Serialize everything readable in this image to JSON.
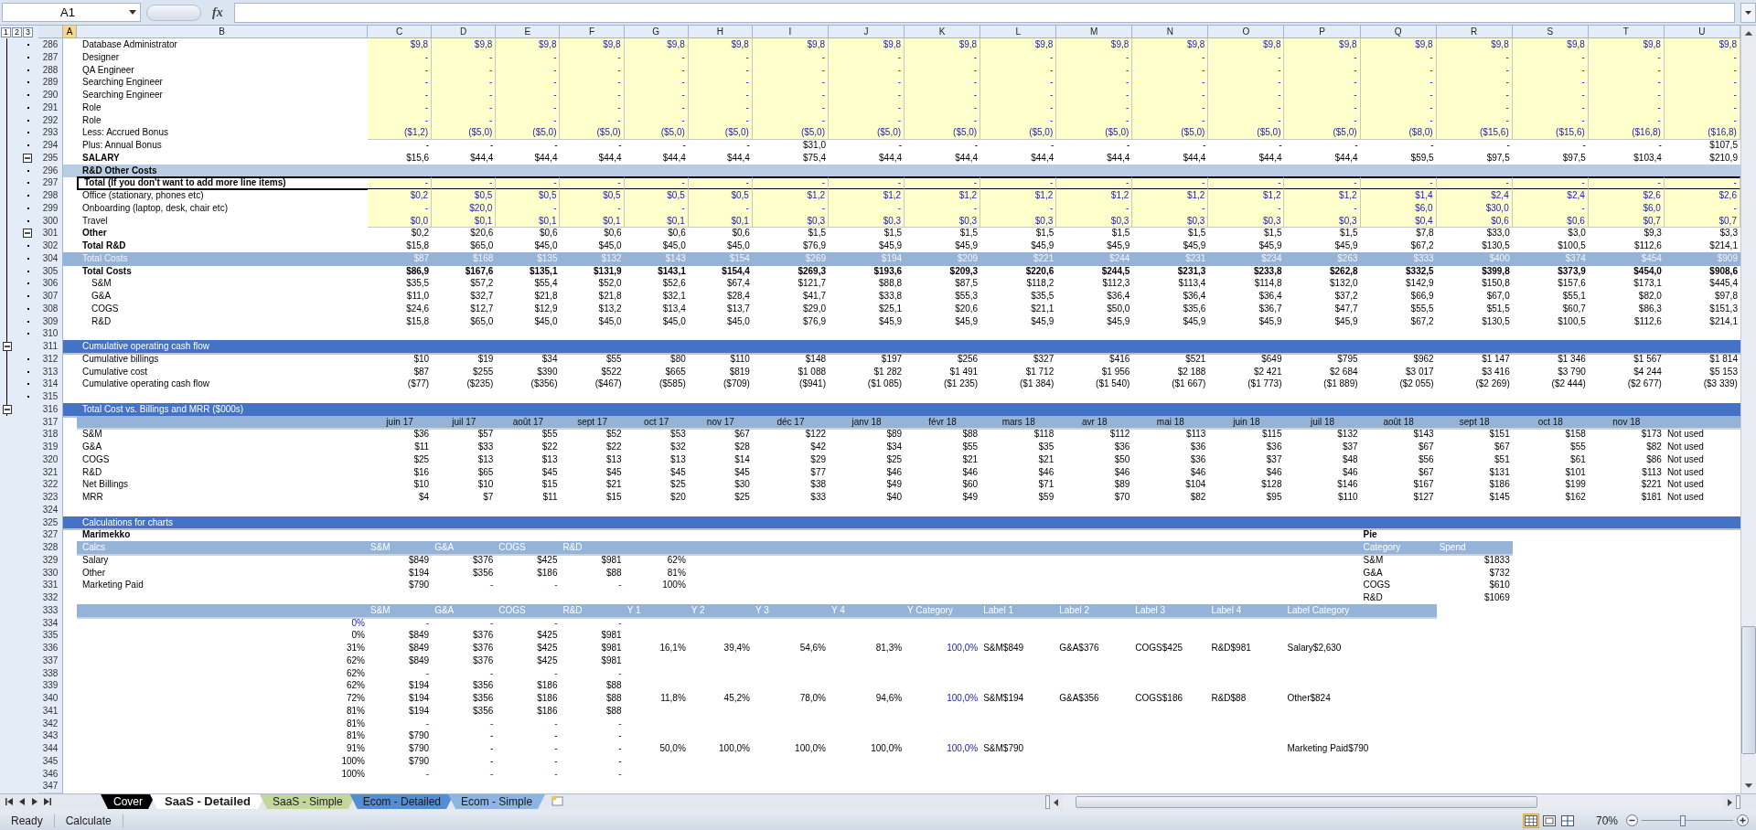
{
  "formula_bar": {
    "name_box": "A1",
    "function_label": "fx"
  },
  "outline_levels": [
    "1",
    "2",
    "3"
  ],
  "columns": [
    {
      "letter": "A",
      "selected": true
    },
    {
      "letter": "B",
      "selected": false
    },
    {
      "letter": "C",
      "selected": false
    },
    {
      "letter": "D",
      "selected": false
    },
    {
      "letter": "E",
      "selected": false
    },
    {
      "letter": "F",
      "selected": false
    },
    {
      "letter": "G",
      "selected": false
    },
    {
      "letter": "H",
      "selected": false
    },
    {
      "letter": "I",
      "selected": false
    },
    {
      "letter": "J",
      "selected": false
    },
    {
      "letter": "K",
      "selected": false
    },
    {
      "letter": "L",
      "selected": false
    },
    {
      "letter": "M",
      "selected": false
    },
    {
      "letter": "N",
      "selected": false
    },
    {
      "letter": "O",
      "selected": false
    },
    {
      "letter": "P",
      "selected": false
    },
    {
      "letter": "Q",
      "selected": false
    },
    {
      "letter": "R",
      "selected": false
    },
    {
      "letter": "S",
      "selected": false
    },
    {
      "letter": "T",
      "selected": false
    },
    {
      "letter": "U",
      "selected": false
    }
  ],
  "rows": [
    {
      "num": "286",
      "kind": "input",
      "outline": {
        "kind": "dot"
      },
      "label": "Database Administrator",
      "cells": [
        "$9,8",
        "$9,8",
        "$9,8",
        "$9,8",
        "$9,8",
        "$9,8",
        "$9,8",
        "$9,8",
        "$9,8",
        "$9,8",
        "$9,8",
        "$9,8",
        "$9,8",
        "$9,8",
        "$9,8",
        "$9,8",
        "$9,8",
        "$9,8",
        "$9,8"
      ]
    },
    {
      "num": "287",
      "kind": "input",
      "outline": {
        "kind": "dot"
      },
      "label": "Designer",
      "cells": [
        "-",
        "-",
        "-",
        "-",
        "-",
        "-",
        "-",
        "-",
        "-",
        "-",
        "-",
        "-",
        "-",
        "-",
        "-",
        "-",
        "-",
        "-",
        "-"
      ]
    },
    {
      "num": "288",
      "kind": "input",
      "outline": {
        "kind": "dot"
      },
      "label": "QA Engineer",
      "cells": [
        "-",
        "-",
        "-",
        "-",
        "-",
        "-",
        "-",
        "-",
        "-",
        "-",
        "-",
        "-",
        "-",
        "-",
        "-",
        "-",
        "-",
        "-",
        "-"
      ]
    },
    {
      "num": "289",
      "kind": "input",
      "outline": {
        "kind": "dot"
      },
      "label": "Searching Engineer",
      "cells": [
        "-",
        "-",
        "-",
        "-",
        "-",
        "-",
        "-",
        "-",
        "-",
        "-",
        "-",
        "-",
        "-",
        "-",
        "-",
        "-",
        "-",
        "-",
        "-"
      ]
    },
    {
      "num": "290",
      "kind": "input",
      "outline": {
        "kind": "dot"
      },
      "label": "Searching Engineer",
      "cells": [
        "-",
        "-",
        "-",
        "-",
        "-",
        "-",
        "-",
        "-",
        "-",
        "-",
        "-",
        "-",
        "-",
        "-",
        "-",
        "-",
        "-",
        "-",
        "-"
      ]
    },
    {
      "num": "291",
      "kind": "input",
      "outline": {
        "kind": "dot"
      },
      "label": "Role",
      "cells": [
        "-",
        "-",
        "-",
        "-",
        "-",
        "-",
        "-",
        "-",
        "-",
        "-",
        "-",
        "-",
        "-",
        "-",
        "-",
        "-",
        "-",
        "-",
        "-"
      ]
    },
    {
      "num": "292",
      "kind": "input",
      "outline": {
        "kind": "dot"
      },
      "label": "Role",
      "cells": [
        "-",
        "-",
        "-",
        "-",
        "-",
        "-",
        "-",
        "-",
        "-",
        "-",
        "-",
        "-",
        "-",
        "-",
        "-",
        "-",
        "-",
        "-",
        "-"
      ]
    },
    {
      "num": "293",
      "kind": "input",
      "outline": {
        "kind": "dot"
      },
      "label": "Less: Accrued Bonus",
      "cells": [
        "($1,2)",
        "($5,0)",
        "($5,0)",
        "($5,0)",
        "($5,0)",
        "($5,0)",
        "($5,0)",
        "($5,0)",
        "($5,0)",
        "($5,0)",
        "($5,0)",
        "($5,0)",
        "($5,0)",
        "($5,0)",
        "($8,0)",
        "($15,6)",
        "($15,6)",
        "($16,8)",
        "($16,8)"
      ]
    },
    {
      "num": "294",
      "kind": "value",
      "outline": {
        "kind": "dot"
      },
      "label": "Plus: Annual Bonus",
      "cells": [
        "-",
        "-",
        "-",
        "-",
        "-",
        "-",
        "$31,0",
        "-",
        "-",
        "-",
        "-",
        "-",
        "-",
        "-",
        "-",
        "-",
        "-",
        "-",
        "$107,5"
      ]
    },
    {
      "num": "295",
      "kind": "value",
      "outline": {
        "kind": "collapse"
      },
      "label_bold": true,
      "label": "SALARY",
      "cells": [
        "$15,6",
        "$44,4",
        "$44,4",
        "$44,4",
        "$44,4",
        "$44,4",
        "$75,4",
        "$44,4",
        "$44,4",
        "$44,4",
        "$44,4",
        "$44,4",
        "$44,4",
        "$44,4",
        "$59,5",
        "$97,5",
        "$97,5",
        "$103,4",
        "$210,9"
      ]
    },
    {
      "num": "296",
      "kind": "band-light",
      "outline": {
        "kind": "dot"
      },
      "label": "R&D Other Costs"
    },
    {
      "num": "297",
      "kind": "boxed",
      "outline": {
        "kind": "dot"
      },
      "label": "Total (If you don't want to add more line items)",
      "cells": [
        "-",
        "-",
        "-",
        "-",
        "-",
        "-",
        "-",
        "-",
        "-",
        "-",
        "-",
        "-",
        "-",
        "-",
        "-",
        "-",
        "-",
        "-",
        "-"
      ]
    },
    {
      "num": "298",
      "kind": "input",
      "outline": {
        "kind": "dot"
      },
      "label": "Office (stationary, phones etc)",
      "cells": [
        "$0,2",
        "$0,5",
        "$0,5",
        "$0,5",
        "$0,5",
        "$0,5",
        "$1,2",
        "$1,2",
        "$1,2",
        "$1,2",
        "$1,2",
        "$1,2",
        "$1,2",
        "$1,2",
        "$1,4",
        "$2,4",
        "$2,4",
        "$2,6",
        "$2,6"
      ]
    },
    {
      "num": "299",
      "kind": "input",
      "outline": {
        "kind": "dot"
      },
      "label": "Onboarding (laptop, desk, chair etc)",
      "cells": [
        "-",
        "$20,0",
        "-",
        "-",
        "-",
        "-",
        "-",
        "-",
        "-",
        "-",
        "-",
        "-",
        "-",
        "-",
        "$6,0",
        "$30,0",
        "-",
        "$6,0",
        "-"
      ]
    },
    {
      "num": "300",
      "kind": "input",
      "outline": {
        "kind": "dot"
      },
      "label": "Travel",
      "cells": [
        "$0,0",
        "$0,1",
        "$0,1",
        "$0,1",
        "$0,1",
        "$0,1",
        "$0,3",
        "$0,3",
        "$0,3",
        "$0,3",
        "$0,3",
        "$0,3",
        "$0,3",
        "$0,3",
        "$0,4",
        "$0,6",
        "$0,6",
        "$0,7",
        "$0,7"
      ]
    },
    {
      "num": "301",
      "kind": "value",
      "outline": {
        "kind": "collapse"
      },
      "label_bold": true,
      "label": "Other",
      "cells": [
        "$0,2",
        "$20,6",
        "$0,6",
        "$0,6",
        "$0,6",
        "$0,6",
        "$1,5",
        "$1,5",
        "$1,5",
        "$1,5",
        "$1,5",
        "$1,5",
        "$1,5",
        "$1,5",
        "$7,8",
        "$33,0",
        "$3,0",
        "$9,3",
        "$3,3"
      ]
    },
    {
      "num": "302",
      "kind": "value",
      "outline": {
        "kind": "dot"
      },
      "label_bold": true,
      "label": "Total R&D",
      "cells": [
        "$15,8",
        "$65,0",
        "$45,0",
        "$45,0",
        "$45,0",
        "$45,0",
        "$76,9",
        "$45,9",
        "$45,9",
        "$45,9",
        "$45,9",
        "$45,9",
        "$45,9",
        "$45,9",
        "$67,2",
        "$130,5",
        "$100,5",
        "$112,6",
        "$214,1"
      ]
    },
    {
      "num": "304",
      "kind": "band-values",
      "outline": {
        "kind": "dot"
      },
      "label": "Total Costs",
      "cells": [
        "$87",
        "$168",
        "$135",
        "$132",
        "$143",
        "$154",
        "$269",
        "$194",
        "$209",
        "$221",
        "$244",
        "$231",
        "$234",
        "$263",
        "$333",
        "$400",
        "$374",
        "$454",
        "$909"
      ]
    },
    {
      "num": "305",
      "kind": "value",
      "outline": {
        "kind": "dot"
      },
      "label_bold": true,
      "values_bold": true,
      "label": "Total Costs",
      "cells": [
        "$86,9",
        "$167,6",
        "$135,1",
        "$131,9",
        "$143,1",
        "$154,4",
        "$269,3",
        "$193,6",
        "$209,3",
        "$220,6",
        "$244,5",
        "$231,3",
        "$233,8",
        "$262,8",
        "$332,5",
        "$399,8",
        "$373,9",
        "$454,0",
        "$908,6"
      ]
    },
    {
      "num": "306",
      "kind": "value",
      "outline": {
        "kind": "dot"
      },
      "indent": true,
      "label": "S&M",
      "cells": [
        "$35,5",
        "$57,2",
        "$55,4",
        "$52,0",
        "$52,6",
        "$67,4",
        "$121,7",
        "$88,8",
        "$87,5",
        "$118,2",
        "$112,3",
        "$113,4",
        "$114,8",
        "$132,0",
        "$142,9",
        "$150,8",
        "$157,6",
        "$173,1",
        "$445,4"
      ]
    },
    {
      "num": "307",
      "kind": "value",
      "outline": {
        "kind": "dot"
      },
      "indent": true,
      "label": "G&A",
      "cells": [
        "$11,0",
        "$32,7",
        "$21,8",
        "$21,8",
        "$32,1",
        "$28,4",
        "$41,7",
        "$33,8",
        "$55,3",
        "$35,5",
        "$36,4",
        "$36,4",
        "$36,4",
        "$37,2",
        "$66,9",
        "$67,0",
        "$55,1",
        "$82,0",
        "$97,8"
      ]
    },
    {
      "num": "308",
      "kind": "value",
      "outline": {
        "kind": "dot"
      },
      "indent": true,
      "label": "COGS",
      "cells": [
        "$24,6",
        "$12,7",
        "$12,9",
        "$13,2",
        "$13,4",
        "$13,7",
        "$29,0",
        "$25,1",
        "$20,6",
        "$21,1",
        "$50,0",
        "$35,6",
        "$36,7",
        "$47,7",
        "$55,5",
        "$51,5",
        "$60,7",
        "$86,3",
        "$151,3"
      ]
    },
    {
      "num": "309",
      "kind": "value",
      "outline": {
        "kind": "dot"
      },
      "indent": true,
      "label": "R&D",
      "cells": [
        "$15,8",
        "$65,0",
        "$45,0",
        "$45,0",
        "$45,0",
        "$45,0",
        "$76,9",
        "$45,9",
        "$45,9",
        "$45,9",
        "$45,9",
        "$45,9",
        "$45,9",
        "$45,9",
        "$67,2",
        "$130,5",
        "$100,5",
        "$112,6",
        "$214,1"
      ]
    },
    {
      "num": "310",
      "kind": "empty",
      "outline": {
        "kind": "dot"
      }
    },
    {
      "num": "311",
      "kind": "band",
      "outline": {
        "kind": "collapse-outer"
      },
      "label": "Cumulative operating cash flow"
    },
    {
      "num": "312",
      "kind": "value",
      "outline": {
        "kind": "dot"
      },
      "label": "Cumulative billings",
      "cells": [
        "$10",
        "$19",
        "$34",
        "$55",
        "$80",
        "$110",
        "$148",
        "$197",
        "$256",
        "$327",
        "$416",
        "$521",
        "$649",
        "$795",
        "$962",
        "$1 147",
        "$1 346",
        "$1 567",
        "$1 814"
      ]
    },
    {
      "num": "313",
      "kind": "value",
      "outline": {
        "kind": "dot"
      },
      "label": "Cumulative cost",
      "cells": [
        "$87",
        "$255",
        "$390",
        "$522",
        "$665",
        "$819",
        "$1 088",
        "$1 282",
        "$1 491",
        "$1 712",
        "$1 956",
        "$2 188",
        "$2 421",
        "$2 684",
        "$3 017",
        "$3 416",
        "$3 790",
        "$4 244",
        "$5 153"
      ]
    },
    {
      "num": "314",
      "kind": "value",
      "outline": {
        "kind": "dot"
      },
      "label": "Cumulative operating cash flow",
      "cells": [
        "($77)",
        "($235)",
        "($356)",
        "($467)",
        "($585)",
        "($709)",
        "($941)",
        "($1 085)",
        "($1 235)",
        "($1 384)",
        "($1 540)",
        "($1 667)",
        "($1 773)",
        "($1 889)",
        "($2 055)",
        "($2 269)",
        "($2 444)",
        "($2 677)",
        "($3 339)"
      ]
    },
    {
      "num": "315",
      "kind": "empty",
      "outline": {
        "kind": "dot"
      }
    },
    {
      "num": "316",
      "kind": "band",
      "outline": {
        "kind": "collapse-outer"
      },
      "label": "Total Cost vs. Billings and MRR ($000s)"
    },
    {
      "num": "317",
      "kind": "months",
      "cells": [
        "juin 17",
        "juil 17",
        "août 17",
        "sept 17",
        "oct 17",
        "nov 17",
        "déc 17",
        "janv 18",
        "févr 18",
        "mars 18",
        "avr 18",
        "mai 18",
        "juin 18",
        "juil 18",
        "août 18",
        "sept 18",
        "oct 18",
        "nov 18"
      ]
    },
    {
      "num": "318",
      "kind": "value",
      "label": "S&M",
      "note": "Not used",
      "cells": [
        "$36",
        "$57",
        "$55",
        "$52",
        "$53",
        "$67",
        "$122",
        "$89",
        "$88",
        "$118",
        "$112",
        "$113",
        "$115",
        "$132",
        "$143",
        "$151",
        "$158",
        "$173"
      ]
    },
    {
      "num": "319",
      "kind": "value",
      "label": "G&A",
      "note": "Not used",
      "cells": [
        "$11",
        "$33",
        "$22",
        "$22",
        "$32",
        "$28",
        "$42",
        "$34",
        "$55",
        "$35",
        "$36",
        "$36",
        "$36",
        "$37",
        "$67",
        "$67",
        "$55",
        "$82"
      ]
    },
    {
      "num": "320",
      "kind": "value",
      "label": "COGS",
      "note": "Not used",
      "cells": [
        "$25",
        "$13",
        "$13",
        "$13",
        "$13",
        "$14",
        "$29",
        "$25",
        "$21",
        "$21",
        "$50",
        "$36",
        "$37",
        "$48",
        "$56",
        "$51",
        "$61",
        "$86"
      ]
    },
    {
      "num": "321",
      "kind": "value",
      "label": "R&D",
      "note": "Not used",
      "cells": [
        "$16",
        "$65",
        "$45",
        "$45",
        "$45",
        "$45",
        "$77",
        "$46",
        "$46",
        "$46",
        "$46",
        "$46",
        "$46",
        "$46",
        "$67",
        "$131",
        "$101",
        "$113"
      ]
    },
    {
      "num": "322",
      "kind": "value",
      "label": "Net Billings",
      "note": "Not used",
      "cells": [
        "$10",
        "$10",
        "$15",
        "$21",
        "$25",
        "$30",
        "$38",
        "$49",
        "$60",
        "$71",
        "$89",
        "$104",
        "$128",
        "$146",
        "$167",
        "$186",
        "$199",
        "$221"
      ]
    },
    {
      "num": "323",
      "kind": "value",
      "label": "MRR",
      "note": "Not used",
      "cells": [
        "$4",
        "$7",
        "$11",
        "$15",
        "$20",
        "$25",
        "$33",
        "$40",
        "$49",
        "$59",
        "$70",
        "$82",
        "$95",
        "$110",
        "$127",
        "$145",
        "$162",
        "$181"
      ]
    },
    {
      "num": "324",
      "kind": "empty"
    },
    {
      "num": "325",
      "kind": "band",
      "label": "Calculations for charts"
    },
    {
      "num": "327",
      "kind": "title",
      "label": "Marimekko",
      "pie_title": "Pie"
    },
    {
      "num": "328",
      "kind": "table-header",
      "label": "Calcs",
      "cells": [
        "S&M",
        "G&A",
        "COGS",
        "R&D"
      ],
      "pie": [
        "Category",
        "Spend"
      ]
    },
    {
      "num": "329",
      "kind": "value",
      "label": "Salary",
      "cells": [
        "$849",
        "$376",
        "$425",
        "$981",
        "62%"
      ],
      "pie": [
        "S&M",
        "$1833"
      ]
    },
    {
      "num": "330",
      "kind": "value",
      "label": "Other",
      "cells": [
        "$194",
        "$356",
        "$186",
        "$88",
        "81%"
      ],
      "pie": [
        "G&A",
        "$732"
      ]
    },
    {
      "num": "331",
      "kind": "value",
      "label": "Marketing Paid",
      "cells": [
        "$790",
        {
          "text": "-",
          "input": true
        },
        {
          "text": "-",
          "input": true
        },
        {
          "text": "-",
          "input": true
        },
        "100%"
      ],
      "pie": [
        "COGS",
        "$610"
      ]
    },
    {
      "num": "332",
      "kind": "empty",
      "pie": [
        "R&D",
        "$1069"
      ]
    },
    {
      "num": "333",
      "kind": "table-header",
      "cells": [
        "S&M",
        "G&A",
        "COGS",
        "R&D",
        "Y 1",
        "Y 2",
        "Y 3",
        "Y 4",
        "Y Category"
      ],
      "labels": [
        "Label 1",
        "Label 2",
        "Label 3",
        "Label 4"
      ],
      "label_category": "Label Category"
    },
    {
      "num": "334",
      "kind": "calc",
      "label": "0%",
      "label_input": true,
      "cells": [
        {
          "text": "-",
          "input": true
        },
        {
          "text": "-",
          "input": true
        },
        {
          "text": "-",
          "input": true
        },
        {
          "text": "-",
          "input": true
        }
      ]
    },
    {
      "num": "335",
      "kind": "calc",
      "label": "0%",
      "cells": [
        "$849",
        "$376",
        "$425",
        "$981"
      ]
    },
    {
      "num": "336",
      "kind": "calc",
      "label": "31%",
      "cells": [
        "$849",
        "$376",
        "$425",
        "$981",
        "16,1%",
        "39,4%",
        "54,6%",
        "81,3%",
        {
          "text": "100,0%",
          "input": true
        }
      ],
      "labels": [
        "S&M$849",
        "G&A$376",
        "COGS$425",
        "R&D$981"
      ],
      "label_category": "Salary$2,630"
    },
    {
      "num": "337",
      "kind": "calc",
      "label": "62%",
      "cells": [
        "$849",
        "$376",
        "$425",
        "$981"
      ]
    },
    {
      "num": "338",
      "kind": "calc",
      "label": "62%",
      "cells": [
        {
          "text": "-",
          "input": true
        },
        {
          "text": "-",
          "input": true
        },
        {
          "text": "-",
          "input": true
        },
        {
          "text": "-",
          "input": true
        }
      ]
    },
    {
      "num": "339",
      "kind": "calc",
      "label": "62%",
      "cells": [
        "$194",
        "$356",
        "$186",
        "$88"
      ]
    },
    {
      "num": "340",
      "kind": "calc",
      "label": "72%",
      "cells": [
        "$194",
        "$356",
        "$186",
        "$88",
        "11,8%",
        "45,2%",
        "78,0%",
        "94,6%",
        {
          "text": "100,0%",
          "input": true
        }
      ],
      "labels": [
        "S&M$194",
        "G&A$356",
        "COGS$186",
        "R&D$88"
      ],
      "label_category": "Other$824"
    },
    {
      "num": "341",
      "kind": "calc",
      "label": "81%",
      "cells": [
        "$194",
        "$356",
        "$186",
        "$88"
      ]
    },
    {
      "num": "342",
      "kind": "calc",
      "label": "81%",
      "cells": [
        {
          "text": "-",
          "input": true
        },
        {
          "text": "-",
          "input": true
        },
        {
          "text": "-",
          "input": true
        },
        {
          "text": "-",
          "input": true
        }
      ]
    },
    {
      "num": "343",
      "kind": "calc",
      "label": "81%",
      "cells": [
        "$790",
        "-",
        "-",
        "-"
      ]
    },
    {
      "num": "344",
      "kind": "calc",
      "label": "91%",
      "cells": [
        "$790",
        "-",
        "-",
        "-",
        "50,0%",
        "100,0%",
        "100,0%",
        "100,0%",
        {
          "text": "100,0%",
          "input": true
        }
      ],
      "labels": [
        "S&M$790"
      ],
      "label_category": "Marketing Paid$790"
    },
    {
      "num": "345",
      "kind": "calc",
      "label": "100%",
      "cells": [
        "$790",
        "-",
        "-",
        "-"
      ]
    },
    {
      "num": "346",
      "kind": "calc",
      "label": "100%",
      "cells": [
        {
          "text": "-",
          "input": true
        },
        {
          "text": "-",
          "input": true
        },
        {
          "text": "-",
          "input": true
        },
        {
          "text": "-",
          "input": true
        }
      ]
    },
    {
      "num": "347",
      "kind": "empty"
    }
  ],
  "sheet_tabs": [
    {
      "label": "Cover",
      "selected": false,
      "color": "#000000"
    },
    {
      "label": "SaaS - Detailed",
      "selected": true
    },
    {
      "label": "SaaS - Simple",
      "selected": false,
      "color": "#c4d79b"
    },
    {
      "label": "Ecom - Detailed",
      "selected": false,
      "color": "#538dd5"
    },
    {
      "label": "Ecom - Simple",
      "selected": false,
      "color": "#8db4e2"
    }
  ],
  "status_bar": {
    "mode": "Ready",
    "calc": "Calculate",
    "zoom": "70%",
    "zoom_slider": {
      "level": 0.45
    }
  }
}
